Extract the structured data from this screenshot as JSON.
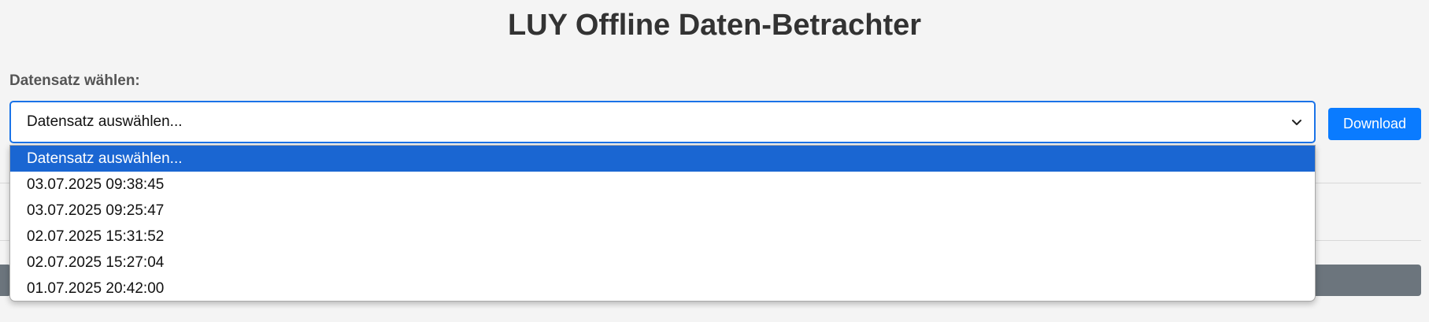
{
  "page": {
    "title": "LUY Offline Daten-Betrachter"
  },
  "dataset": {
    "label": "Datensatz wählen:",
    "selected": "Datensatz auswählen...",
    "options": [
      "Datensatz auswählen...",
      "03.07.2025 09:38:45",
      "03.07.2025 09:25:47",
      "02.07.2025 15:31:52",
      "02.07.2025 15:27:04",
      "01.07.2025 20:42:00"
    ]
  },
  "toolbar": {
    "download_label": "Download"
  },
  "colors": {
    "accent": "#0a7bff",
    "option_highlight": "#1a66d2",
    "secondary_button": "#6c757d"
  }
}
